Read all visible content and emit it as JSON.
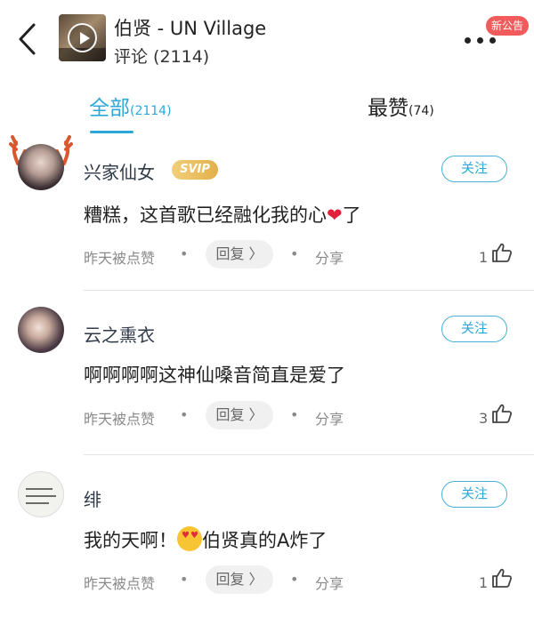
{
  "header": {
    "song_title": "伯贤 - UN Village",
    "comment_count": "评论 (2114)",
    "notice_badge": "新公告"
  },
  "tabs": [
    {
      "label": "全部",
      "count": "(2114)",
      "active": true
    },
    {
      "label": "最赞",
      "count": "(74)",
      "active": false
    }
  ],
  "colors": {
    "accent": "#2ea7d8",
    "badge_red": "#f25b5b",
    "heart": "#e0203a",
    "svip_gold": "#e2b04a"
  },
  "comments": [
    {
      "username": "兴家仙女",
      "vip_badge": "SVIP",
      "follow_label": "关注",
      "text_before": "糟糕，这首歌已经融化我的心",
      "emoji": "heart-icon",
      "text_after": "了",
      "like_by": "昨天被点赞",
      "reply_label": "回复 〉",
      "share_label": "分享",
      "likes": "1"
    },
    {
      "username": "云之熏衣",
      "follow_label": "关注",
      "text": "啊啊啊啊这神仙嗓音简直是爱了",
      "like_by": "昨天被点赞",
      "reply_label": "回复 〉",
      "share_label": "分享",
      "likes": "3"
    },
    {
      "username": "绯",
      "follow_label": "关注",
      "text_before": "我的天啊！",
      "emoji": "heart-eyes-emoji",
      "text_after": "伯贤真的A炸了",
      "like_by": "昨天被点赞",
      "reply_label": "回复 〉",
      "share_label": "分享",
      "likes": "1"
    }
  ]
}
